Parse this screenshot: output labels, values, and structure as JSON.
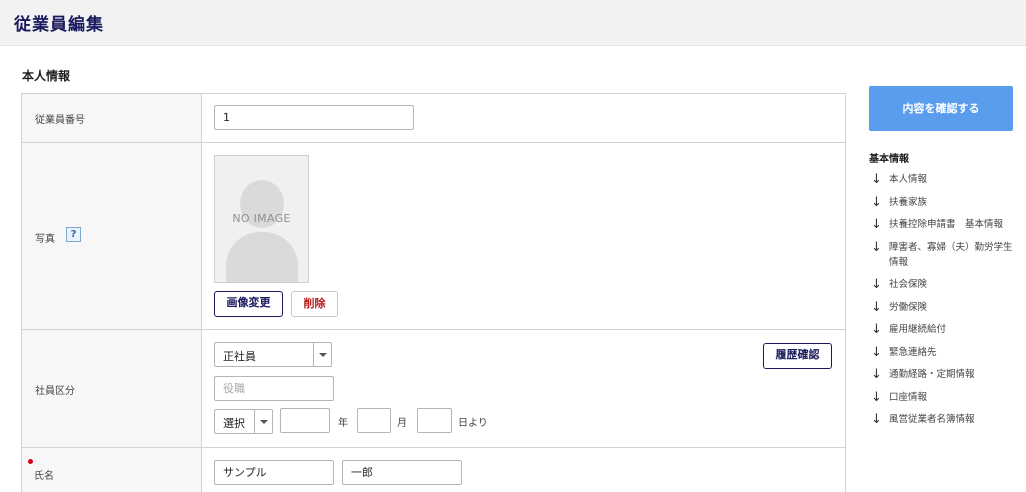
{
  "page": {
    "title": "従業員編集"
  },
  "section": {
    "title": "本人情報"
  },
  "form": {
    "employee_number": {
      "label": "従業員番号",
      "value": "1"
    },
    "photo": {
      "label": "写真",
      "help_icon": "?",
      "placeholder_text": "NO IMAGE",
      "change_button": "画像変更",
      "delete_button": "削除"
    },
    "employment_type": {
      "label": "社員区分",
      "type_value": "正社員",
      "history_button": "履歴確認",
      "position_placeholder": "役職",
      "era_value": "選択",
      "year_value": "",
      "year_unit": "年",
      "month_value": "",
      "month_unit": "月",
      "day_value": "",
      "day_unit": "日より"
    },
    "name": {
      "label": "氏名",
      "last_name": "サンプル",
      "first_name": "一郎"
    }
  },
  "sidebar": {
    "confirm_button": "内容を確認する",
    "nav_title": "基本情報",
    "nav_items": [
      "本人情報",
      "扶養家族",
      "扶養控除申請書　基本情報",
      "障害者、寡婦（夫）勤労学生情報",
      "社会保険",
      "労働保険",
      "雇用継続給付",
      "緊急連絡先",
      "通勤経路・定期情報",
      "口座情報",
      "風営従業者名簿情報"
    ]
  },
  "colors": {
    "title": "#1a1a5e",
    "confirm_button_bg": "#5b9ded",
    "delete_text": "#b31b1b",
    "required_dot": "#d0021b"
  },
  "icons": [
    "help-icon",
    "select-arrow-icon",
    "arrow-down-icon",
    "person-silhouette-icon"
  ]
}
